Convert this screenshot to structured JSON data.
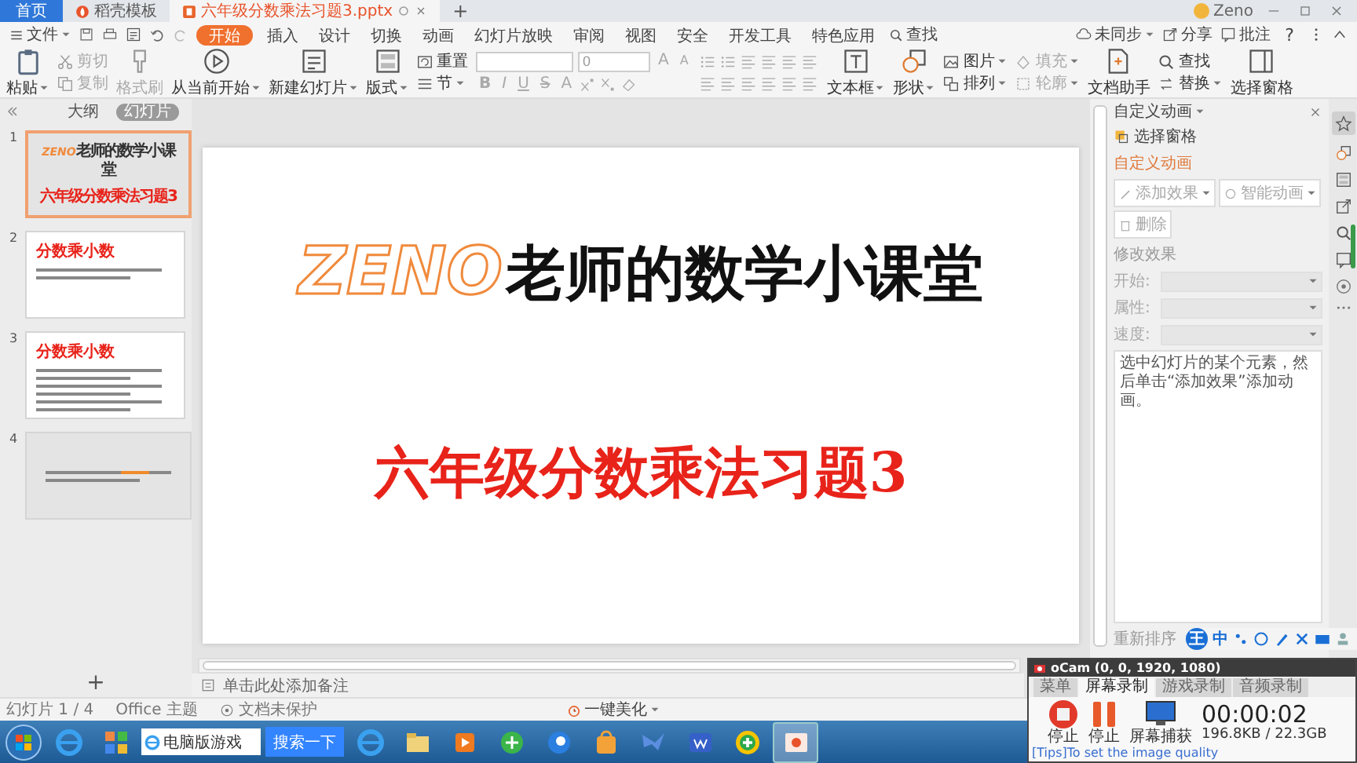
{
  "doc_tabs": [
    {
      "label": "首页",
      "kind": "home",
      "selected": false
    },
    {
      "label": "稻壳模板",
      "kind": "template",
      "selected": false
    },
    {
      "label": "六年级分数乘法习题3.pptx",
      "kind": "file",
      "selected": true
    }
  ],
  "new_tab": "+",
  "account": {
    "name": "Zeno"
  },
  "menu": {
    "file": "文件",
    "tabs": [
      {
        "label": "开始",
        "selected": true
      },
      {
        "label": "插入",
        "selected": false
      },
      {
        "label": "设计",
        "selected": false
      },
      {
        "label": "切换",
        "selected": false
      },
      {
        "label": "动画",
        "selected": false
      },
      {
        "label": "幻灯片放映",
        "selected": false
      },
      {
        "label": "审阅",
        "selected": false
      },
      {
        "label": "视图",
        "selected": false
      },
      {
        "label": "安全",
        "selected": false
      },
      {
        "label": "开发工具",
        "selected": false
      },
      {
        "label": "特色应用",
        "selected": false
      }
    ],
    "search": "查找",
    "right": [
      {
        "label": "未同步",
        "kind": "sync"
      },
      {
        "label": "分享",
        "kind": "share"
      },
      {
        "label": "批注",
        "kind": "comment"
      }
    ],
    "help": "?"
  },
  "ribbon_left": [
    {
      "kind": "large",
      "items": [
        {
          "label": "粘贴",
          "dropdown": true,
          "disabled": false
        }
      ]
    },
    {
      "kind": "stack",
      "items": [
        {
          "label": "剪切",
          "dropdown": false,
          "disabled": true
        },
        {
          "label": "复制",
          "dropdown": false,
          "disabled": true
        }
      ]
    },
    {
      "kind": "large",
      "items": [
        {
          "label": "格式刷",
          "dropdown": false,
          "disabled": true
        }
      ]
    },
    {
      "kind": "large",
      "items": [
        {
          "label": "从当前开始",
          "dropdown": true,
          "disabled": false
        }
      ]
    },
    {
      "kind": "large",
      "items": [
        {
          "label": "新建幻灯片",
          "dropdown": true,
          "disabled": false
        }
      ]
    },
    {
      "kind": "large",
      "items": [
        {
          "label": "版式",
          "dropdown": true,
          "disabled": false
        }
      ]
    },
    {
      "kind": "stack",
      "items": [
        {
          "label": "重置",
          "dropdown": false,
          "disabled": false
        },
        {
          "label": "节",
          "dropdown": true,
          "disabled": false
        }
      ]
    }
  ],
  "font": {
    "size": "0",
    "grow": "A",
    "shrink": "A",
    "styles": [
      "B",
      "I",
      "U",
      "S",
      "A"
    ]
  },
  "ribbon_right": [
    {
      "kind": "large",
      "items": [
        {
          "label": "文本框",
          "dropdown": true,
          "disabled": false
        }
      ]
    },
    {
      "kind": "large",
      "items": [
        {
          "label": "形状",
          "dropdown": true,
          "disabled": false
        }
      ]
    },
    {
      "kind": "stack",
      "items": [
        {
          "label": "图片",
          "dropdown": true,
          "disabled": false
        },
        {
          "label": "排列",
          "dropdown": true,
          "disabled": false
        }
      ]
    },
    {
      "kind": "stack",
      "items": [
        {
          "label": "填充",
          "dropdown": true,
          "disabled": true
        },
        {
          "label": "轮廓",
          "dropdown": true,
          "disabled": true
        }
      ]
    },
    {
      "kind": "large",
      "items": [
        {
          "label": "文档助手",
          "dropdown": false,
          "disabled": false
        }
      ]
    },
    {
      "kind": "stack",
      "items": [
        {
          "label": "查找",
          "dropdown": false,
          "disabled": false
        },
        {
          "label": "替换",
          "dropdown": true,
          "disabled": false
        }
      ]
    },
    {
      "kind": "large",
      "items": [
        {
          "label": "选择窗格",
          "dropdown": false,
          "disabled": false
        }
      ]
    }
  ],
  "view_tabs": [
    {
      "label": "大纲",
      "selected": false
    },
    {
      "label": "幻灯片",
      "selected": true
    }
  ],
  "slides": [
    {
      "number": "1",
      "kind": "title",
      "selected": true,
      "brand": "ZENO",
      "title": "老师的数学小课堂",
      "subtitle": "六年级分数乘法习题3"
    },
    {
      "number": "2",
      "kind": "text",
      "selected": false,
      "title": "分数乘小数"
    },
    {
      "number": "3",
      "kind": "text",
      "selected": false,
      "title": "分数乘小数"
    },
    {
      "number": "4",
      "kind": "body",
      "selected": false
    }
  ],
  "add_slide": "+",
  "slide": {
    "brand": "ZENO",
    "title": "老师的数学小课堂",
    "subtitle": "六年级分数乘法习题3"
  },
  "notes_placeholder": "单击此处添加备注",
  "animation_pane": {
    "title": "自定义动画",
    "select_pane": "选择窗格",
    "section": "自定义动画",
    "buttons": [
      {
        "label": "添加效果",
        "dropdown": true,
        "disabled": true
      },
      {
        "label": "智能动画",
        "dropdown": true,
        "disabled": true
      },
      {
        "label": "删除",
        "dropdown": false,
        "disabled": true
      }
    ],
    "modify": "修改效果",
    "fields": [
      {
        "label": "开始:",
        "disabled": true
      },
      {
        "label": "属性:",
        "disabled": true
      },
      {
        "label": "速度:",
        "disabled": true
      }
    ],
    "hint": "选中幻灯片的某个元素，然后单击“添加效果”添加动画。",
    "reorder": "重新排序"
  },
  "ime": {
    "logo": "王",
    "mode": "中"
  },
  "status": {
    "slide": "幻灯片 1 / 4",
    "theme": "Office 主题",
    "protection": "文档未保护",
    "beautify": "一键美化"
  },
  "taskbar": {
    "search_value": "电脑版游戏",
    "search_button": "搜索一下"
  },
  "ocam": {
    "title": "oCam (0, 0, 1920, 1080)",
    "tabs": [
      {
        "label": "菜单",
        "selected": false
      },
      {
        "label": "屏幕录制",
        "selected": true
      },
      {
        "label": "游戏录制",
        "selected": false
      },
      {
        "label": "音频录制",
        "selected": false
      }
    ],
    "actions": [
      "停止",
      "停止",
      "屏幕捕获"
    ],
    "timer": "00:00:02",
    "size": "196.8KB / 22.3GB",
    "tips": "[Tips]To set the image quality"
  }
}
